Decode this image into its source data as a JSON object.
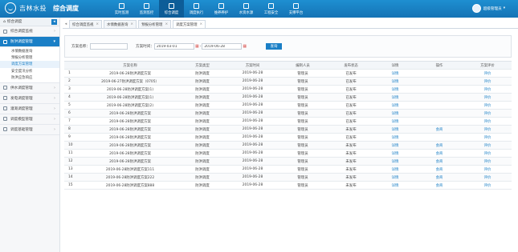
{
  "header": {
    "brand": "吉林水投",
    "module": "综合调度",
    "nav": [
      {
        "label": "实时监测",
        "active": false
      },
      {
        "label": "监测监控",
        "active": false
      },
      {
        "label": "综合调度",
        "active": true
      },
      {
        "label": "调度执行",
        "active": false
      },
      {
        "label": "维养养护",
        "active": false
      },
      {
        "label": "水资水源",
        "active": false
      },
      {
        "label": "工程安全",
        "active": false
      },
      {
        "label": "支撑平台",
        "active": false
      }
    ],
    "user": "超级管理员"
  },
  "sidebar": {
    "home": "综合调度",
    "items": [
      {
        "label": "综合调度监视",
        "active": false
      },
      {
        "label": "防洪调度管理",
        "active": true
      },
      {
        "label": "供水调度管理",
        "active": false
      },
      {
        "label": "发电调度管理",
        "active": false
      },
      {
        "label": "灌溉调度管理",
        "active": false
      },
      {
        "label": "调度模型管理",
        "active": false
      },
      {
        "label": "调度基础管理",
        "active": false
      }
    ],
    "subitems": [
      {
        "label": "水情数据查询",
        "active": false
      },
      {
        "label": "预报分析管理",
        "active": false
      },
      {
        "label": "调度方案管理",
        "active": true
      },
      {
        "label": "安全度汛分析",
        "active": false
      },
      {
        "label": "防洪应急响应",
        "active": false
      }
    ]
  },
  "tabs": [
    {
      "label": "综合调度监视",
      "active": false
    },
    {
      "label": "水情数据查询",
      "active": false
    },
    {
      "label": "预报分析管理",
      "active": false
    },
    {
      "label": "调度方案管理",
      "active": true
    }
  ],
  "search": {
    "name_label": "方案名称：",
    "name_value": "",
    "time_label": "方案时间：",
    "start": "2019-03-01",
    "sep": "-",
    "end": "2019-06-28",
    "button": "查询"
  },
  "table": {
    "headers": [
      "",
      "方案名称",
      "方案类型",
      "方案时间",
      "编制人员",
      "发布状态",
      "详情",
      "操作",
      "方案评价"
    ],
    "rows": [
      [
        "1",
        "2019-06-28防洪调度方案",
        "防洪调度",
        "2019-06-28",
        "管理员",
        "已发布",
        "详情",
        "",
        "评价"
      ],
      [
        "2",
        "2019-06-27防洪调度方案（0705）",
        "防洪调度",
        "2019-06-28",
        "管理员",
        "已发布",
        "详情",
        "",
        "评价"
      ],
      [
        "3",
        "2019-06-28防洪调度方案(1)",
        "防洪调度",
        "2019-06-28",
        "管理员",
        "已发布",
        "详情",
        "",
        "评价"
      ],
      [
        "4",
        "2019-06-28防洪调度方案(1)",
        "防洪调度",
        "2019-06-28",
        "管理员",
        "已发布",
        "详情",
        "",
        "评价"
      ],
      [
        "5",
        "2019-06-28防洪调度方案(2)",
        "防洪调度",
        "2019-06-28",
        "管理员",
        "已发布",
        "详情",
        "",
        "评价"
      ],
      [
        "6",
        "2019-06-28防洪调度方案",
        "防洪调度",
        "2019-06-28",
        "管理员",
        "已发布",
        "详情",
        "",
        "评价"
      ],
      [
        "7",
        "2019-06-28防洪调度方案",
        "防洪调度",
        "2019-06-28",
        "管理员",
        "已发布",
        "详情",
        "",
        "评价"
      ],
      [
        "8",
        "2019-06-28防洪调度方案",
        "防洪调度",
        "2019-06-28",
        "管理员",
        "未发布",
        "详情",
        "会商",
        "评价"
      ],
      [
        "9",
        "2019-06-28防洪调度方案",
        "防洪调度",
        "2019-06-28",
        "管理员",
        "已发布",
        "详情",
        "",
        "评价"
      ],
      [
        "10",
        "2019-06-28防洪调度方案",
        "防洪调度",
        "2019-06-28",
        "管理员",
        "未发布",
        "详情",
        "会商",
        "评价"
      ],
      [
        "11",
        "2019-06-28防洪调度方案",
        "防洪调度",
        "2019-06-28",
        "管理员",
        "未发布",
        "详情",
        "会商",
        "评价"
      ],
      [
        "12",
        "2019-06-28防洪调度方案",
        "防洪调度",
        "2019-06-28",
        "管理员",
        "未发布",
        "详情",
        "会商",
        "评价"
      ],
      [
        "13",
        "2019-06-28防洪调度方案111",
        "防洪调度",
        "2019-06-28",
        "管理员",
        "未发布",
        "详情",
        "会商",
        "评价"
      ],
      [
        "14",
        "2019-06-28防洪调度方案222",
        "防洪调度",
        "2019-06-28",
        "管理员",
        "未发布",
        "详情",
        "会商",
        "评价"
      ],
      [
        "15",
        "2019-06-28防洪调度方案888",
        "防洪调度",
        "2019-06-28",
        "管理员",
        "未发布",
        "详情",
        "会商",
        "评价"
      ]
    ]
  },
  "colors": {
    "header": "#1a7fc6",
    "accent": "#1a7fc6",
    "link": "#1a7fc6",
    "calendar": "#d9534f"
  }
}
